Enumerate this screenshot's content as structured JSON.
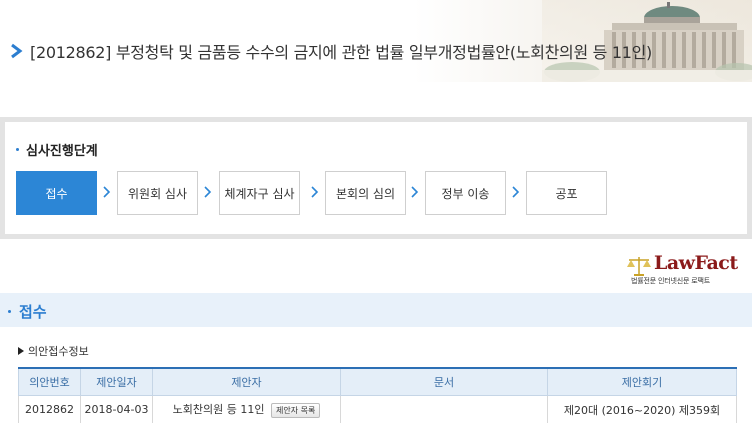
{
  "header": {
    "title": "[2012862] 부정청탁 및 금품등 수수의 금지에 관한 법률 일부개정법률안(노회찬의원 등 11인)"
  },
  "progress": {
    "title": "심사진행단계",
    "steps": [
      {
        "label": "접수",
        "active": true
      },
      {
        "label": "위원회 심사",
        "active": false
      },
      {
        "label": "체계자구 심사",
        "active": false
      },
      {
        "label": "본회의 심의",
        "active": false
      },
      {
        "label": "정부 이송",
        "active": false
      },
      {
        "label": "공포",
        "active": false
      }
    ]
  },
  "logo": {
    "name": "LawFact",
    "subtitle": "법률전문 인터넷신문 로팩트"
  },
  "section": {
    "title": "접수",
    "subtitle": "의안접수정보"
  },
  "table": {
    "headers": [
      "의안번호",
      "제안일자",
      "제안자",
      "문서",
      "제안회기"
    ],
    "rows": [
      {
        "bill_no": "2012862",
        "date": "2018-04-03",
        "proposer": "노회찬의원 등 11인",
        "proposer_button": "제안자 목록",
        "document": "",
        "session": "제20대 (2016~2020) 제359회"
      }
    ]
  },
  "colors": {
    "accent": "#2c86d6",
    "section_bg": "#e8f1fa",
    "table_header_bg": "#e4eef8",
    "logo_red": "#8b1a1a"
  }
}
